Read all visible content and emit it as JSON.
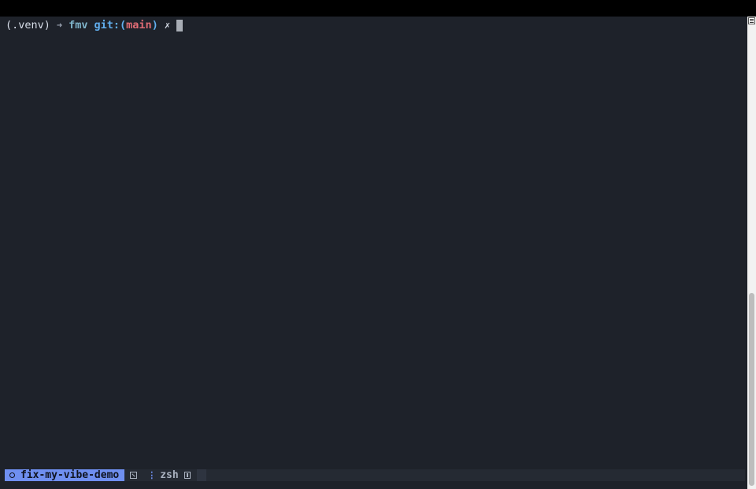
{
  "prompt": {
    "venv": "(.venv)",
    "arrow": "➜",
    "directory": "fmv",
    "git_prefix": "git:(",
    "branch": "main",
    "git_suffix": ")",
    "dirty_marker": "✗"
  },
  "statusbar": {
    "session_name": "fix-my-vibe-demo",
    "pane_separator": "⋮",
    "pane_name": "zsh"
  },
  "colors": {
    "background": "#1e222a",
    "directory": "#7fb4ca",
    "git": "#61afef",
    "branch": "#e06c75",
    "session_accent": "#6f8ff0"
  },
  "icons": {
    "session": "circle-icon",
    "zoom": "zoom-pane-icon",
    "pane": "pane-layout-icon"
  }
}
